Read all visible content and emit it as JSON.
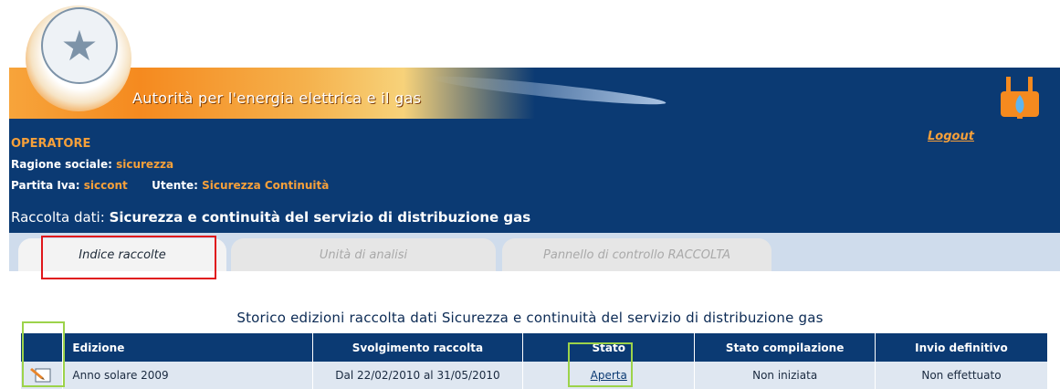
{
  "header": {
    "banner_title": "Autorità per l'energia elettrica e il gas"
  },
  "operator": {
    "title": "OPERATORE",
    "ragione_label": "Ragione sociale:",
    "ragione_value": "sicurezza",
    "piva_label": "Partita Iva:",
    "piva_value": "siccont",
    "utente_label": "Utente:",
    "utente_value": "Sicurezza Continuità",
    "logout": "Logout",
    "raccolta_label": "Raccolta dati:",
    "raccolta_value": "Sicurezza e continuità del servizio di distribuzione gas"
  },
  "tabs": [
    {
      "label": "Indice raccolte"
    },
    {
      "label": "Unità di analisi"
    },
    {
      "label": "Pannello di controllo RACCOLTA"
    }
  ],
  "table": {
    "caption": "Storico edizioni raccolta dati Sicurezza e continuità del servizio di distribuzione gas",
    "headers": [
      "",
      "Edizione",
      "Svolgimento raccolta",
      "Stato",
      "Stato compilazione",
      "Invio definitivo"
    ],
    "rows": [
      {
        "icon": "edit-icon",
        "edizione": "Anno solare 2009",
        "svolgimento": "Dal 22/02/2010 al 31/05/2010",
        "stato": "Aperta",
        "stato_compilazione": "Non iniziata",
        "invio": "Non effettuato"
      }
    ]
  },
  "colors": {
    "navy": "#0b3a73",
    "orange": "#f6a03a",
    "highlight_red": "#e0161b",
    "highlight_green": "#9cd34a"
  }
}
